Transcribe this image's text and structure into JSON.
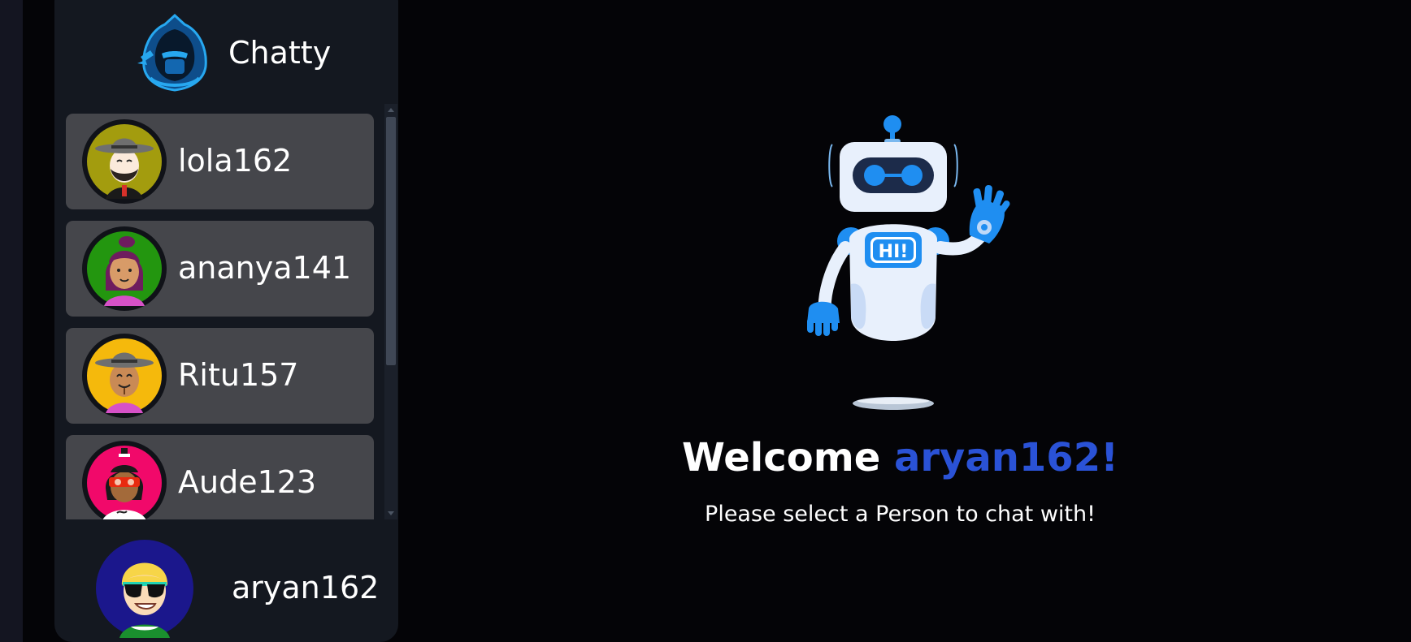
{
  "app": {
    "name": "Chatty",
    "logo_icon": "hooded-ninja-logo-icon"
  },
  "contacts": [
    {
      "username": "lola162",
      "avatar_icon": "avatar-bearded-man-hat-icon",
      "avatar_bg": "#a39c0e"
    },
    {
      "username": "ananya141",
      "avatar_icon": "avatar-woman-purple-hair-icon",
      "avatar_bg": "#23960f"
    },
    {
      "username": "Ritu157",
      "avatar_icon": "avatar-man-hat-smiling-icon",
      "avatar_bg": "#f5b90c"
    },
    {
      "username": "Aude123",
      "avatar_icon": "avatar-masked-person-icon",
      "avatar_bg": "#f1096a"
    }
  ],
  "current_user": {
    "username": "aryan162",
    "avatar_icon": "avatar-blonde-sunglasses-icon",
    "avatar_bg": "#1b178c"
  },
  "welcome": {
    "greeting": "Welcome",
    "username": "aryan162!",
    "subtitle": "Please select a Person to chat with!",
    "illustration_icon": "waving-robot-hi-icon"
  },
  "colors": {
    "background": "#040407",
    "sidebar": "#141820",
    "card": "#45464b",
    "accent": "#2a52d6",
    "robot_blue": "#1f8ef1"
  }
}
